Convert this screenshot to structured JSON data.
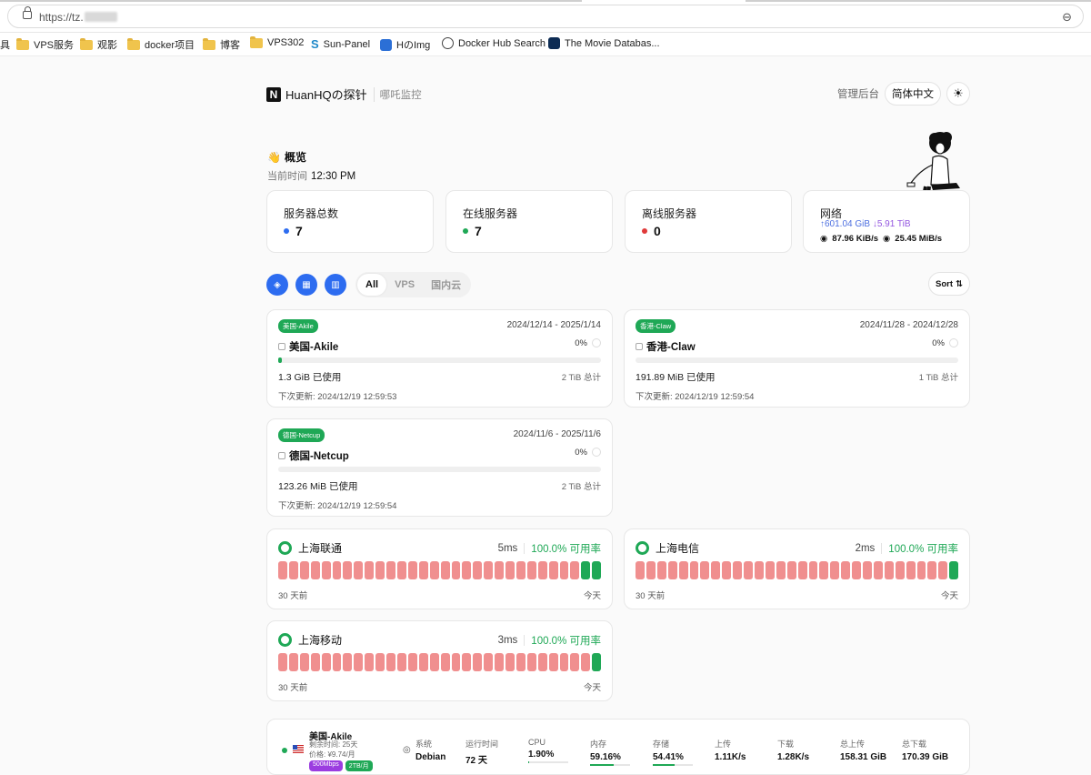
{
  "browser": {
    "url_prefix": "https://tz.",
    "bookmarks": [
      {
        "label": "VPS服务",
        "icon": "folder-icon"
      },
      {
        "label": "观影",
        "icon": "folder-icon"
      },
      {
        "label": "docker项目",
        "icon": "folder-icon"
      },
      {
        "label": "博客",
        "icon": "folder-icon"
      },
      {
        "label": "VPS302",
        "icon": "folder-icon"
      },
      {
        "label": "Sun-Panel",
        "icon": "sun-panel-icon"
      },
      {
        "label": "HのImg",
        "icon": "image-icon"
      },
      {
        "label": "Docker Hub Search",
        "icon": "docker-icon"
      },
      {
        "label": "The Movie Databas...",
        "icon": "tmdb-icon"
      }
    ]
  },
  "header": {
    "logo_letter": "N",
    "brand": "HuanHQの探针",
    "subtitle": "哪吒监控",
    "admin_label": "管理后台",
    "language": "简体中文"
  },
  "overview": {
    "title": "概览",
    "time_label": "当前时间",
    "time_value": "12:30 PM"
  },
  "stats": {
    "total_label": "服务器总数",
    "total_value": "7",
    "online_label": "在线服务器",
    "online_value": "7",
    "offline_label": "离线服务器",
    "offline_value": "0",
    "network_label": "网络",
    "net_up_total": "↑601.04 GiB",
    "net_down_total": "↓5.91 TiB",
    "net_up_speed": "87.96 KiB/s",
    "net_down_speed": "25.45 MiB/s"
  },
  "toolbar": {
    "tabs": [
      "All",
      "VPS",
      "国内云"
    ],
    "sort_label": "Sort"
  },
  "servers": [
    {
      "badge": "美国-Akile",
      "date_range": "2024/12/14 - 2025/1/14",
      "name": "美国-Akile",
      "percent": "0%",
      "progress": 0.01,
      "used": "1.3 GiB 已使用",
      "total": "2 TiB 总计",
      "next": "下次更新: 2024/12/19 12:59:53"
    },
    {
      "badge": "香港-Claw",
      "date_range": "2024/11/28 - 2024/12/28",
      "name": "香港-Claw",
      "percent": "0%",
      "progress": 0,
      "used": "191.89 MiB 已使用",
      "total": "1 TiB 总计",
      "next": "下次更新: 2024/12/19 12:59:54"
    },
    {
      "badge": "德国-Netcup",
      "date_range": "2024/11/6 - 2025/11/6",
      "name": "德国-Netcup",
      "percent": "0%",
      "progress": 0,
      "used": "123.26 MiB 已使用",
      "total": "2 TiB 总计",
      "next": "下次更新: 2024/12/19 12:59:54"
    }
  ],
  "monitors": [
    {
      "name": "上海联通",
      "latency": "5ms",
      "availability": "100.0% 可用率",
      "start": "30 天前",
      "end": "今天",
      "green_count": 2
    },
    {
      "name": "上海电信",
      "latency": "2ms",
      "availability": "100.0% 可用率",
      "start": "30 天前",
      "end": "今天",
      "green_count": 1
    },
    {
      "name": "上海移动",
      "latency": "3ms",
      "availability": "100.0% 可用率",
      "start": "30 天前",
      "end": "今天",
      "green_count": 1
    }
  ],
  "server_row": {
    "name": "美国-Akile",
    "remaining": "剩余时间: 25天",
    "price": "价格: ¥9.74/月",
    "tags": [
      {
        "label": "500Mbps",
        "color": "#9b3de0"
      },
      {
        "label": "2TB/月",
        "color": "#1fa856"
      }
    ],
    "cols": [
      {
        "k": "系统",
        "v": "Debian"
      },
      {
        "k": "运行时间",
        "v": "72 天"
      },
      {
        "k": "CPU",
        "v": "1.90%",
        "bar": 0.02
      },
      {
        "k": "内存",
        "v": "59.16%",
        "bar": 0.59
      },
      {
        "k": "存储",
        "v": "54.41%",
        "bar": 0.54
      },
      {
        "k": "上传",
        "v": "1.11K/s"
      },
      {
        "k": "下载",
        "v": "1.28K/s"
      },
      {
        "k": "总上传",
        "v": "158.31 GiB"
      },
      {
        "k": "总下载",
        "v": "170.39 GiB"
      }
    ]
  }
}
